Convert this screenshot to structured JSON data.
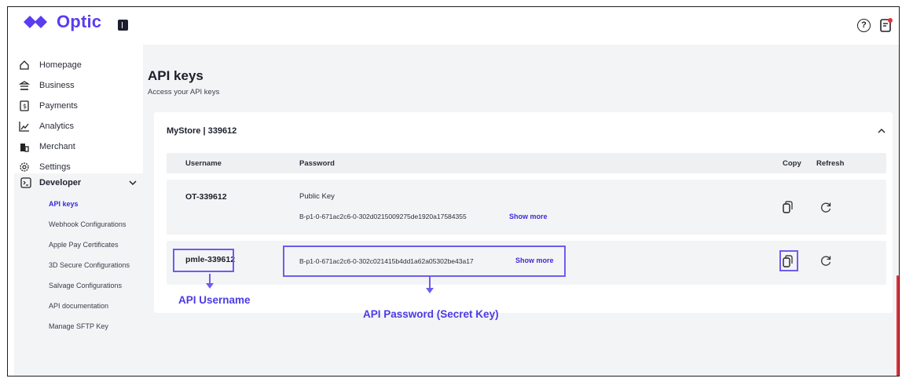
{
  "app": {
    "brand": "Optic",
    "brand_color": "#5a3df0"
  },
  "header": {
    "help_icon": "question-circle-icon",
    "notification_icon": "notification-doc-icon",
    "help_glyph": "?"
  },
  "sidebar": {
    "items": [
      {
        "label": "Homepage",
        "icon": "home-icon"
      },
      {
        "label": "Business",
        "icon": "bank-icon"
      },
      {
        "label": "Payments",
        "icon": "payments-icon"
      },
      {
        "label": "Analytics",
        "icon": "analytics-icon"
      },
      {
        "label": "Merchant",
        "icon": "merchant-icon"
      },
      {
        "label": "Settings",
        "icon": "gear-icon"
      }
    ],
    "developer": {
      "label": "Developer",
      "icon": "terminal-icon",
      "subitems": [
        {
          "label": "API keys",
          "active": true
        },
        {
          "label": "Webhook Configurations"
        },
        {
          "label": "Apple Pay Certificates"
        },
        {
          "label": "3D Secure Configurations"
        },
        {
          "label": "Salvage Configurations"
        },
        {
          "label": "API documentation"
        },
        {
          "label": "Manage SFTP Key"
        }
      ]
    }
  },
  "main": {
    "title": "API keys",
    "subtitle": "Access your API keys",
    "store": {
      "title": "MyStore | 339612",
      "columns": {
        "username": "Username",
        "password": "Password",
        "copy": "Copy",
        "refresh": "Refresh"
      },
      "rows": [
        {
          "username": "OT-339612",
          "password_label": "Public Key",
          "password": "B-p1-0-671ac2c6-0-302d0215009275de1920a17584355",
          "show_more": "Show more"
        },
        {
          "username": "pmle-339612",
          "password": "B-p1-0-671ac2c6-0-302c021415b4dd1a62a05302be43a17",
          "show_more": "Show more"
        }
      ]
    }
  },
  "annotations": {
    "username_label": "API Username",
    "password_label": "API Password (Secret Key)",
    "color": "#4b3be6"
  },
  "colors": {
    "accent": "#3a2bd8",
    "highlight": "#6d5cf0",
    "scroll": "#e0333e"
  }
}
